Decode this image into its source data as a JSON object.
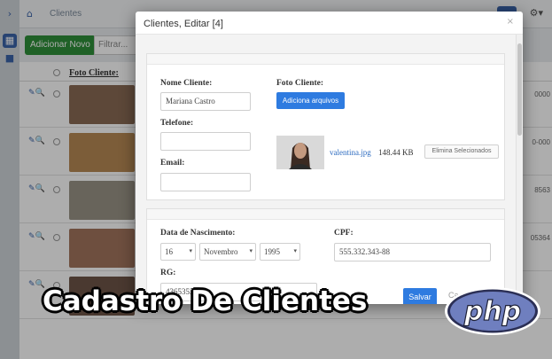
{
  "app": {
    "breadcrumb": "Clientes",
    "toolbar": {
      "new_label": "Adicionar Novo",
      "filter_placeholder": "Filtrar..."
    },
    "table": {
      "photo_header": "Foto Cliente:",
      "rows": [
        {
          "tail": "0000"
        },
        {
          "tail": "0-000"
        },
        {
          "tail": "8563"
        },
        {
          "tail": "05364"
        },
        {
          "tail": ""
        }
      ]
    }
  },
  "modal": {
    "title": "Clientes, Editar [4]",
    "fields": {
      "name_label": "Nome Cliente:",
      "name_value": "Mariana Castro",
      "photo_label": "Foto Cliente:",
      "upload_label": "Adiciona arquivos",
      "file_name": "valentina.jpg",
      "file_size": "148.44 KB",
      "remove_label": "Elimina Selecionados",
      "phone_label": "Telefone:",
      "phone_value": "",
      "email_label": "Email:",
      "email_value": "",
      "birth_label": "Data de Nascimento:",
      "birth_day": "16",
      "birth_month": "Novembro",
      "birth_year": "1995",
      "cpf_label": "CPF:",
      "cpf_value": "555.332.343-88",
      "rg_label": "RG:",
      "rg_value": "436535364"
    },
    "save_label": "Salvar",
    "cancel_label": "Ca"
  },
  "promo": {
    "title": "Cadastro De Clientes",
    "logo_text": "php"
  },
  "colors": {
    "primary": "#2e7be0",
    "success": "#2f8f3a",
    "sidebar_accent": "#3a63a8"
  }
}
